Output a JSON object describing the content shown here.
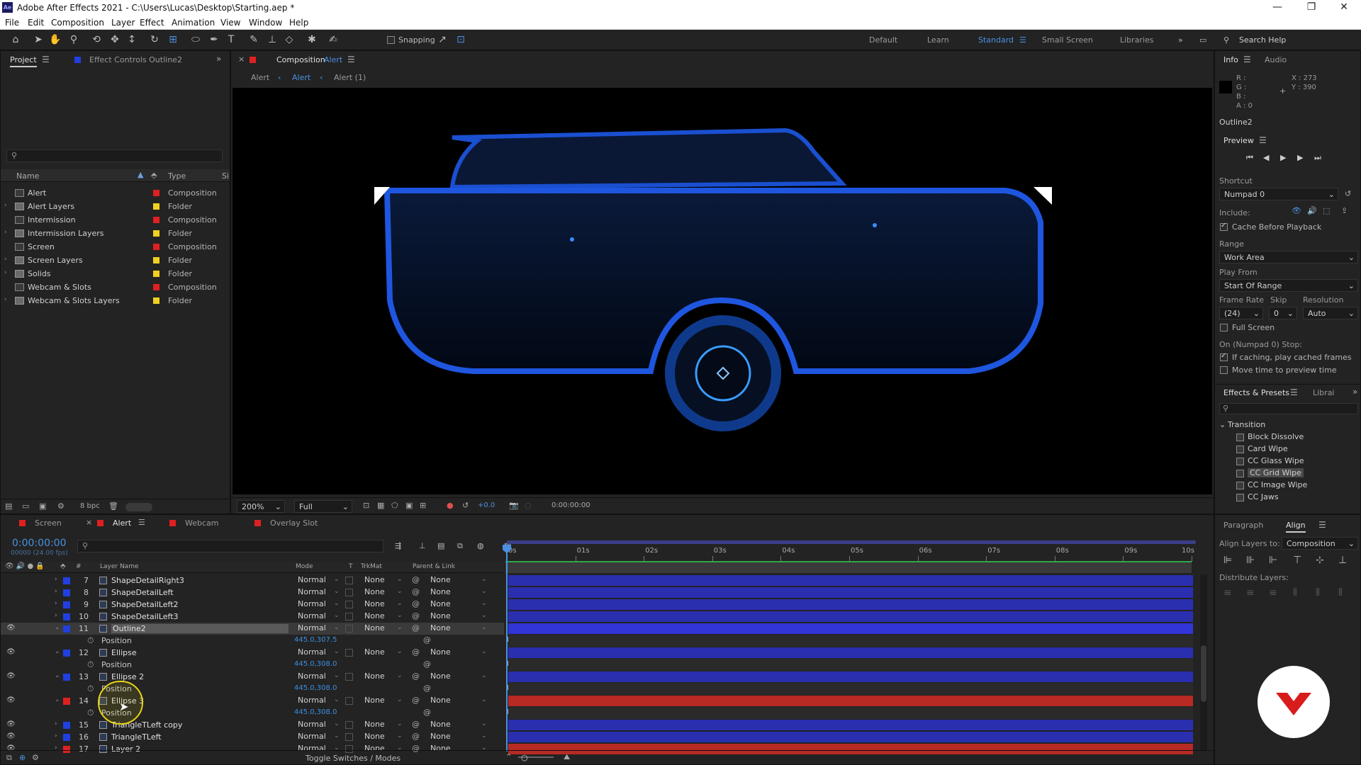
{
  "titlebar": {
    "title": "Adobe After Effects 2021 - C:\\Users\\Lucas\\Desktop\\Starting.aep *",
    "app_abbrev": "Ae"
  },
  "menu": [
    "File",
    "Edit",
    "Composition",
    "Layer",
    "Effect",
    "Animation",
    "View",
    "Window",
    "Help"
  ],
  "toolbar": {
    "snapping_label": "Snapping",
    "workspaces": [
      "Default",
      "Learn",
      "Standard",
      "Small Screen",
      "Libraries"
    ],
    "active_workspace": "Standard",
    "search_help": "Search Help"
  },
  "project": {
    "tab_project": "Project",
    "tab_effect_controls": "Effect Controls Outline2",
    "col_name": "Name",
    "col_type": "Type",
    "col_size": "Si",
    "bpc": "8 bpc",
    "items": [
      {
        "name": "Alert",
        "type": "Composition",
        "color": "#e02020",
        "kind": "comp",
        "expandable": false
      },
      {
        "name": "Alert Layers",
        "type": "Folder",
        "color": "#f0d020",
        "kind": "folder",
        "expandable": true
      },
      {
        "name": "Intermission",
        "type": "Composition",
        "color": "#e02020",
        "kind": "comp",
        "expandable": false
      },
      {
        "name": "Intermission Layers",
        "type": "Folder",
        "color": "#f0d020",
        "kind": "folder",
        "expandable": true
      },
      {
        "name": "Screen",
        "type": "Composition",
        "color": "#e02020",
        "kind": "comp",
        "expandable": false
      },
      {
        "name": "Screen Layers",
        "type": "Folder",
        "color": "#f0d020",
        "kind": "folder",
        "expandable": true
      },
      {
        "name": "Solids",
        "type": "Folder",
        "color": "#f0d020",
        "kind": "folder",
        "expandable": true
      },
      {
        "name": "Webcam & Slots",
        "type": "Composition",
        "color": "#e02020",
        "kind": "comp",
        "expandable": false
      },
      {
        "name": "Webcam & Slots Layers",
        "type": "Folder",
        "color": "#f0d020",
        "kind": "folder",
        "expandable": true
      }
    ]
  },
  "composition": {
    "tab_prefix": "Composition",
    "tab_name": "Alert",
    "breadcrumbs": [
      "Alert",
      "Alert",
      "Alert (1)"
    ],
    "zoom": "200%",
    "resolution": "Full",
    "exposure": "+0.0",
    "timecode": "0:00:00:00"
  },
  "info": {
    "tab_info": "Info",
    "tab_audio": "Audio",
    "r": "R :",
    "g": "G :",
    "b": "B :",
    "a": "A : 0",
    "x": "X : 273",
    "y": "Y : 390",
    "layer": "Outline2"
  },
  "preview": {
    "title": "Preview",
    "shortcut_label": "Shortcut",
    "shortcut_value": "Numpad 0",
    "include_label": "Include:",
    "cache_label": "Cache Before Playback",
    "range_label": "Range",
    "range_value": "Work Area",
    "play_from_label": "Play From",
    "play_from_value": "Start Of Range",
    "frame_rate_label": "Frame Rate",
    "skip_label": "Skip",
    "resolution_label": "Resolution",
    "frame_rate_value": "(24)",
    "skip_value": "0",
    "resolution_value": "Auto",
    "full_screen_label": "Full Screen",
    "stop_label": "On (Numpad 0) Stop:",
    "if_caching_label": "If caching, play cached frames",
    "move_time_label": "Move time to preview time"
  },
  "effects": {
    "tab": "Effects & Presets",
    "tab2": "Librai",
    "category": "Transition",
    "items": [
      "Block Dissolve",
      "Card Wipe",
      "CC Glass Wipe",
      "CC Grid Wipe",
      "CC Image Wipe",
      "CC Jaws"
    ],
    "selected": "CC Grid Wipe"
  },
  "timeline": {
    "tabs": [
      {
        "name": "Screen",
        "color": "#e02020"
      },
      {
        "name": "Alert",
        "color": "#e02020"
      },
      {
        "name": "Webcam",
        "color": "#e02020"
      },
      {
        "name": "Overlay Slot",
        "color": "#e02020"
      }
    ],
    "active_tab": "Alert",
    "timecode": "0:00:00:00",
    "frames": "00000 (24.00 fps)",
    "col_layer_name": "Layer Name",
    "col_mode": "Mode",
    "col_t": "T",
    "col_trkmat": "TrkMat",
    "col_parent": "Parent & Link",
    "ruler": [
      "0s",
      "01s",
      "02s",
      "03s",
      "04s",
      "05s",
      "06s",
      "07s",
      "08s",
      "09s",
      "10s"
    ],
    "toggle_label": "Toggle Switches / Modes",
    "rows": [
      {
        "kind": "layer",
        "num": "7",
        "name": "ShapeDetailRight3",
        "mode": "Normal",
        "trk": "None",
        "parent": "None",
        "color": "#2040e0",
        "bar": "#2a2fb0",
        "eye": false,
        "expanded": false
      },
      {
        "kind": "layer",
        "num": "8",
        "name": "ShapeDetailLeft",
        "mode": "Normal",
        "trk": "None",
        "parent": "None",
        "color": "#2040e0",
        "bar": "#2a2fb0",
        "eye": false,
        "expanded": false
      },
      {
        "kind": "layer",
        "num": "9",
        "name": "ShapeDetailLeft2",
        "mode": "Normal",
        "trk": "None",
        "parent": "None",
        "color": "#2040e0",
        "bar": "#2a2fb0",
        "eye": false,
        "expanded": false
      },
      {
        "kind": "layer",
        "num": "10",
        "name": "ShapeDetailLeft3",
        "mode": "Normal",
        "trk": "None",
        "parent": "None",
        "color": "#2040e0",
        "bar": "#2a2fb0",
        "eye": false,
        "expanded": false
      },
      {
        "kind": "layer",
        "num": "11",
        "name": "Outline2",
        "mode": "Normal",
        "trk": "None",
        "parent": "None",
        "color": "#2040e0",
        "bar": "#3236d8",
        "eye": true,
        "expanded": true,
        "selected": true
      },
      {
        "kind": "prop",
        "name": "Position",
        "value": "445.0,307.5"
      },
      {
        "kind": "layer",
        "num": "12",
        "name": "Ellipse",
        "mode": "Normal",
        "trk": "None",
        "parent": "None",
        "color": "#2040e0",
        "bar": "#2a2fb0",
        "eye": true,
        "expanded": true
      },
      {
        "kind": "prop",
        "name": "Position",
        "value": "445.0,308.0"
      },
      {
        "kind": "layer",
        "num": "13",
        "name": "Ellipse 2",
        "mode": "Normal",
        "trk": "None",
        "parent": "None",
        "color": "#2040e0",
        "bar": "#2a2fb0",
        "eye": true,
        "expanded": true
      },
      {
        "kind": "prop",
        "name": "Position",
        "value": "445.0,308.0"
      },
      {
        "kind": "layer",
        "num": "14",
        "name": "Ellipse 3",
        "mode": "Normal",
        "trk": "None",
        "parent": "None",
        "color": "#e02020",
        "bar": "#b82a24",
        "eye": true,
        "expanded": true
      },
      {
        "kind": "prop",
        "name": "Position",
        "value": "445.0,308.0"
      },
      {
        "kind": "layer",
        "num": "15",
        "name": "TriangleTLeft copy",
        "mode": "Normal",
        "trk": "None",
        "parent": "None",
        "color": "#2040e0",
        "bar": "#2a2fb0",
        "eye": true,
        "expanded": false
      },
      {
        "kind": "layer",
        "num": "16",
        "name": "TriangleTLeft",
        "mode": "Normal",
        "trk": "None",
        "parent": "None",
        "color": "#2040e0",
        "bar": "#2a2fb0",
        "eye": true,
        "expanded": false
      },
      {
        "kind": "layer",
        "num": "17",
        "name": "Layer 2",
        "mode": "Normal",
        "trk": "None",
        "parent": "None",
        "color": "#e02020",
        "bar": "#b82a24",
        "eye": true,
        "expanded": false
      }
    ]
  },
  "align": {
    "tab_paragraph": "Paragraph",
    "tab_align": "Align",
    "align_to_label": "Align Layers to:",
    "align_to_value": "Composition",
    "distribute_label": "Distribute Layers:"
  }
}
